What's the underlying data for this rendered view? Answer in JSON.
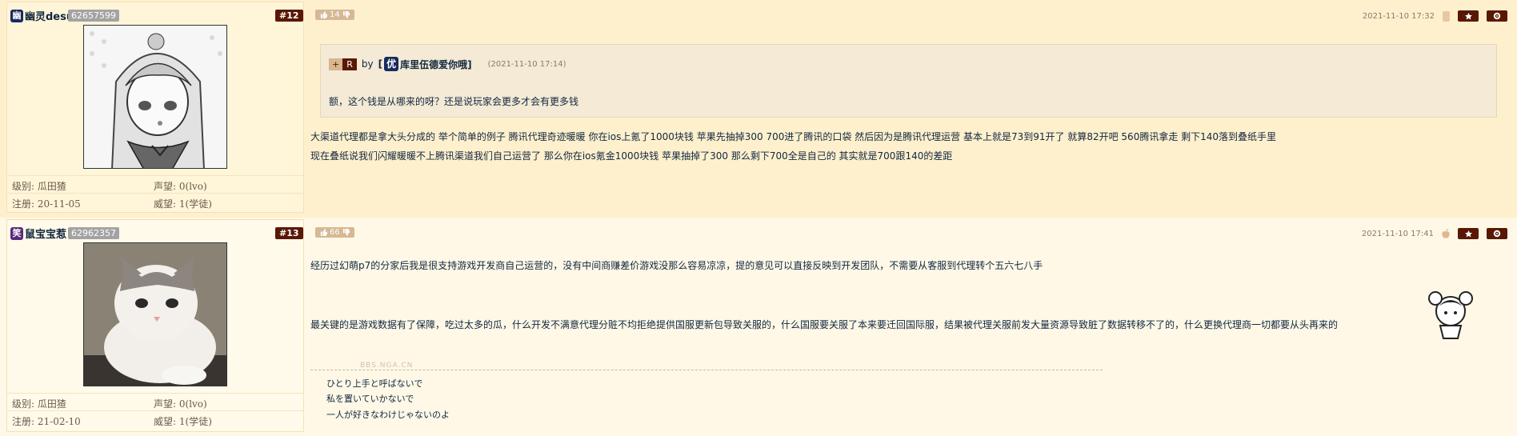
{
  "posts": [
    {
      "username": "幽灵desu",
      "user_icon": "幽",
      "uid": "62657599",
      "floor": "#12",
      "votes": "14",
      "time": "2021-11-10 17:32",
      "stats": {
        "level_label": "级别:",
        "level": "瓜田猹",
        "fame_label": "声望:",
        "fame": "0(lvo)",
        "reg_label": "注册:",
        "reg": "20-11-05",
        "prestige_label": "威望:",
        "prestige": "1(学徒)"
      },
      "quote": {
        "plus": "+",
        "r": "R",
        "by": "by",
        "name_badge": "优",
        "name": "库里伍德爱你哦]",
        "name_open": "[",
        "time": "(2021-11-10 17:14)",
        "text": "额，这个钱是从哪来的呀？还是说玩家会更多才会有更多钱"
      },
      "body": [
        "大渠道代理都是拿大头分成的 举个简单的例子 腾讯代理奇迹暖暖 你在ios上氪了1000块钱 苹果先抽掉300 700进了腾讯的口袋 然后因为是腾讯代理运营 基本上就是73到91开了 就算82开吧 560腾讯拿走 剩下140落到叠纸手里",
        "现在叠纸说我们闪耀暖暖不上腾讯渠道我们自己运营了 那么你在ios氪金1000块钱 苹果抽掉了300 那么剩下700全是自己的 其实就是700跟140的差距"
      ]
    },
    {
      "username": "鼠宝宝惹",
      "user_icon": "笑",
      "uid": "62962357",
      "floor": "#13",
      "votes": "66",
      "time": "2021-11-10 17:41",
      "stats": {
        "level_label": "级别:",
        "level": "瓜田猹",
        "fame_label": "声望:",
        "fame": "0(lvo)",
        "reg_label": "注册:",
        "reg": "21-02-10",
        "prestige_label": "威望:",
        "prestige": "1(学徒)"
      },
      "body": [
        "经历过幻萌p7的分家后我是很支持游戏开发商自己运营的，没有中间商赚差价游戏没那么容易凉凉，提的意见可以直接反映到开发团队，不需要从客服到代理转个五六七八手",
        "最关键的是游戏数据有了保障，吃过太多的瓜，什么开发不满意代理分赃不均拒绝提供国服更新包导致关服的，什么国服要关服了本来要迁回国际服，结果被代理关服前发大量资源导致脏了数据转移不了的，什么更换代理商一切都要从头再来的"
      ],
      "sig_mark": "BBS.NGA.CN",
      "signature": [
        "ひとり上手と呼ばないで",
        "私を置いていかないで",
        "一人が好きなわけじゃないのよ"
      ]
    }
  ],
  "icons": {
    "thumb": "thumb-up-icon",
    "star": "star-icon",
    "gear": "gear-icon"
  },
  "colors": {
    "floor_badge": "#591804",
    "post_bg_odd": "#fff0cd",
    "post_bg_even": "#fff8e7"
  }
}
